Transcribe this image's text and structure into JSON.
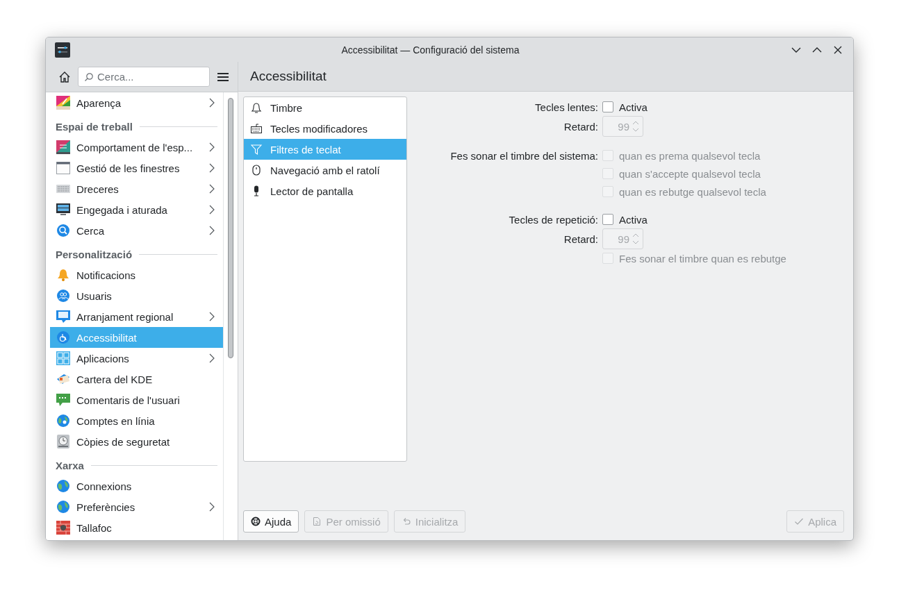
{
  "window": {
    "title": "Accessibilitat — Configuració del sistema"
  },
  "sidebar": {
    "search": {
      "placeholder": "Cerca..."
    },
    "items": [
      {
        "kind": "item",
        "label": "Aparença",
        "submenu": true,
        "selected": false
      },
      {
        "kind": "header",
        "label": "Espai de treball"
      },
      {
        "kind": "item",
        "label": "Comportament de l'esp...",
        "submenu": true,
        "selected": false
      },
      {
        "kind": "item",
        "label": "Gestió de les finestres",
        "submenu": true,
        "selected": false
      },
      {
        "kind": "item",
        "label": "Dreceres",
        "submenu": true,
        "selected": false
      },
      {
        "kind": "item",
        "label": "Engegada i aturada",
        "submenu": true,
        "selected": false
      },
      {
        "kind": "item",
        "label": "Cerca",
        "submenu": true,
        "selected": false
      },
      {
        "kind": "header",
        "label": "Personalització"
      },
      {
        "kind": "item",
        "label": "Notificacions",
        "submenu": false,
        "selected": false
      },
      {
        "kind": "item",
        "label": "Usuaris",
        "submenu": false,
        "selected": false
      },
      {
        "kind": "item",
        "label": "Arranjament regional",
        "submenu": true,
        "selected": false
      },
      {
        "kind": "item",
        "label": "Accessibilitat",
        "submenu": false,
        "selected": true
      },
      {
        "kind": "item",
        "label": "Aplicacions",
        "submenu": true,
        "selected": false
      },
      {
        "kind": "item",
        "label": "Cartera del KDE",
        "submenu": false,
        "selected": false
      },
      {
        "kind": "item",
        "label": "Comentaris de l'usuari",
        "submenu": false,
        "selected": false
      },
      {
        "kind": "item",
        "label": "Comptes en línia",
        "submenu": false,
        "selected": false
      },
      {
        "kind": "item",
        "label": "Còpies de seguretat",
        "submenu": false,
        "selected": false
      },
      {
        "kind": "header",
        "label": "Xarxa"
      },
      {
        "kind": "item",
        "label": "Connexions",
        "submenu": false,
        "selected": false
      },
      {
        "kind": "item",
        "label": "Preferències",
        "submenu": true,
        "selected": false
      },
      {
        "kind": "item",
        "label": "Tallafoc",
        "submenu": false,
        "selected": false
      }
    ]
  },
  "page": {
    "title": "Accessibilitat",
    "tabs": [
      {
        "label": "Timbre",
        "selected": false
      },
      {
        "label": "Tecles modificadores",
        "selected": false
      },
      {
        "label": "Filtres de teclat",
        "selected": true
      },
      {
        "label": "Navegació amb el ratolí",
        "selected": false
      },
      {
        "label": "Lector de pantalla",
        "selected": false
      }
    ],
    "groups": [
      {
        "rows": [
          {
            "kind": "checkbox",
            "label": "Tecles lentes:",
            "text": "Activa",
            "checked": false,
            "disabled": false
          },
          {
            "kind": "spin",
            "label": "Retard:",
            "value": "99",
            "disabled": true
          }
        ]
      },
      {
        "rows": [
          {
            "kind": "checkbox",
            "label": "Fes sonar el timbre del sistema:",
            "text": "quan es prema qualsevol tecla",
            "checked": false,
            "disabled": true
          },
          {
            "kind": "checkbox",
            "text": "quan s'accepte qualsevol tecla",
            "checked": false,
            "disabled": true
          },
          {
            "kind": "checkbox",
            "text": "quan es rebutge qualsevol tecla",
            "checked": false,
            "disabled": true
          }
        ]
      },
      {
        "rows": [
          {
            "kind": "checkbox",
            "label": "Tecles de repetició:",
            "text": "Activa",
            "checked": false,
            "disabled": false
          },
          {
            "kind": "spin",
            "label": "Retard:",
            "value": "99",
            "disabled": true
          },
          {
            "kind": "checkbox",
            "text": "Fes sonar el timbre quan es rebutge",
            "checked": false,
            "disabled": true
          }
        ]
      }
    ],
    "buttons": [
      {
        "label": "Ajuda",
        "disabled": false
      },
      {
        "label": "Per omissió",
        "disabled": true
      },
      {
        "label": "Inicialitza",
        "disabled": true
      },
      {
        "label": "Aplica",
        "disabled": true
      }
    ]
  }
}
